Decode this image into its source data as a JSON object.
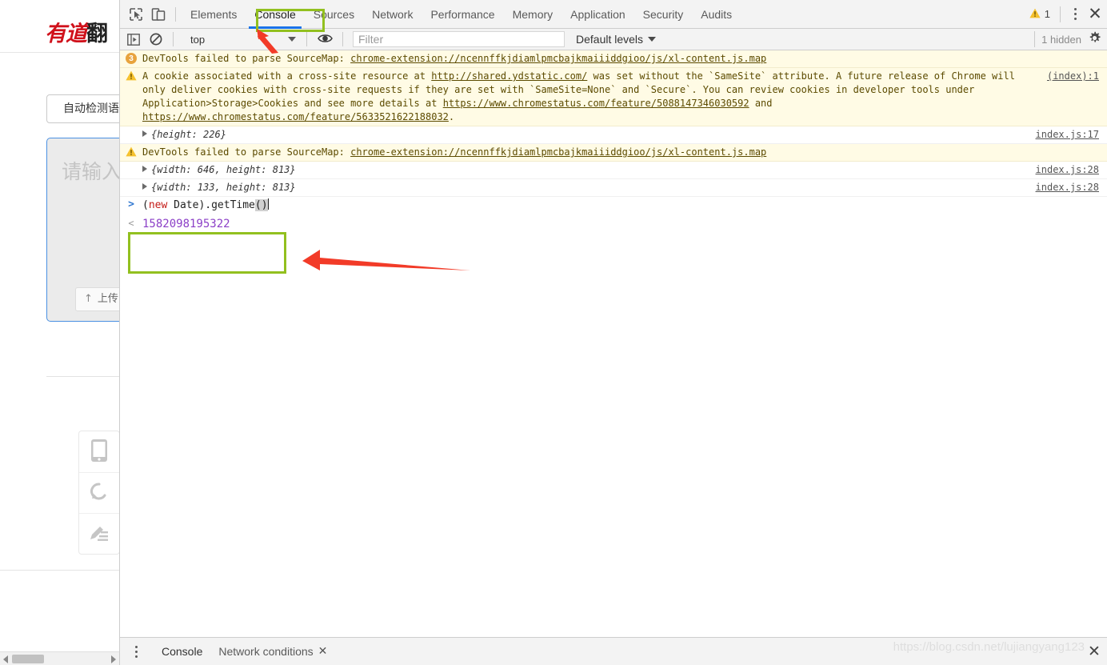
{
  "page_pane": {
    "logo_red": "有道",
    "logo_black": "翻",
    "lang_select": "自动检测语言",
    "textarea_placeholder": "请输入",
    "upload_label": "上传",
    "upload_icon": "upload-arrow-icon",
    "tools": [
      {
        "icon": "mobile-phone-icon",
        "name": "mobile-app-tool"
      },
      {
        "icon": "refresh-circular-icon",
        "name": "refresh-tool"
      },
      {
        "icon": "pen-write-icon",
        "name": "handwriting-tool"
      }
    ]
  },
  "devtools": {
    "toolbar_icons": [
      {
        "name": "inspect-element-icon",
        "title": "Inspect"
      },
      {
        "name": "device-toolbar-icon",
        "title": "Toggle device toolbar"
      }
    ],
    "tabs": [
      {
        "label": "Elements",
        "active": false
      },
      {
        "label": "Console",
        "active": true
      },
      {
        "label": "Sources",
        "active": false
      },
      {
        "label": "Network",
        "active": false
      },
      {
        "label": "Performance",
        "active": false
      },
      {
        "label": "Memory",
        "active": false
      },
      {
        "label": "Application",
        "active": false
      },
      {
        "label": "Security",
        "active": false
      },
      {
        "label": "Audits",
        "active": false
      }
    ],
    "warning_count": "1",
    "warning_icon": "warning-triangle-icon",
    "more_icon": "kebab-menu-icon",
    "close_icon": "close-icon",
    "filterbar": {
      "sidebar_icon": "console-sidebar-icon",
      "clear_icon": "clear-console-icon",
      "context": "top",
      "eye_icon": "live-expression-eye-icon",
      "filter_placeholder": "Filter",
      "filter_value": "",
      "levels": "Default levels",
      "hidden_count": "1 hidden",
      "settings_icon": "gear-icon"
    },
    "messages": [
      {
        "type": "error-group",
        "badge": "3",
        "text": "DevTools failed to parse SourceMap: ",
        "link": "chrome-extension://ncennffkjdiamlpmcbajkmaiiiddgioo/js/xl-content.js.map",
        "source": ""
      },
      {
        "type": "warning",
        "icon": "warning-triangle-icon",
        "text_parts": [
          {
            "t": "A cookie associated with a cross-site resource at ",
            "link": false
          },
          {
            "t": "http://shared.ydstatic.com/",
            "link": true
          },
          {
            "t": " was set without the `SameSite` attribute. A future release of Chrome will only deliver cookies with cross-site requests if they are set with `SameSite=None` and `Secure`. You can review cookies in developer tools under Application>Storage>Cookies and see more details at ",
            "link": false
          },
          {
            "t": "https://www.chromestatus.com/feature/5088147346030592",
            "link": true
          },
          {
            "t": " and ",
            "link": false
          },
          {
            "t": "https://www.chromestatus.com/feature/5633521622188032",
            "link": true
          },
          {
            "t": ".",
            "link": false
          }
        ],
        "source": "(index):1"
      },
      {
        "type": "object",
        "text": "{height: 226}",
        "keys": [
          "height"
        ],
        "values": [
          "226"
        ],
        "source": "index.js:17"
      },
      {
        "type": "warning",
        "icon": "warning-triangle-icon",
        "text_parts": [
          {
            "t": "DevTools failed to parse SourceMap: ",
            "link": false
          },
          {
            "t": "chrome-extension://ncennffkjdiamlpmcbajkmaiiiddgioo/js/xl-content.js.map",
            "link": true
          }
        ],
        "source": ""
      },
      {
        "type": "object",
        "text": "{width: 646, height: 813}",
        "keys": [
          "width",
          "height"
        ],
        "values": [
          "646",
          "813"
        ],
        "source": "index.js:28"
      },
      {
        "type": "object",
        "text": "{width: 133, height: 813}",
        "keys": [
          "width",
          "height"
        ],
        "values": [
          "133",
          "813"
        ],
        "source": "index.js:28"
      }
    ],
    "prompt": {
      "chevron": ">",
      "input_pre": "(",
      "keyword": "new",
      "input_mid": " Date).getTime",
      "input_sel": "()",
      "full_expression": "(new Date).getTime()"
    },
    "result": {
      "chevron": "<",
      "value": "1582098195322"
    },
    "drawer": {
      "kebab_icon": "kebab-menu-icon",
      "tabs": [
        {
          "label": "Console",
          "active": true,
          "closable": false
        },
        {
          "label": "Network conditions",
          "active": false,
          "closable": true
        }
      ],
      "close_label": "✕",
      "close_icon": "close-icon"
    }
  },
  "annotations": {
    "console_tab_box_color": "#92c01f",
    "prompt_box_color": "#92c01f",
    "arrow_color": "#f23b28",
    "arrow_to_console_tab": "red-arrow-icon",
    "arrow_to_result": "red-arrow-icon"
  },
  "watermark": {
    "text": "https://blog.csdn.net/lujiangyang123"
  }
}
